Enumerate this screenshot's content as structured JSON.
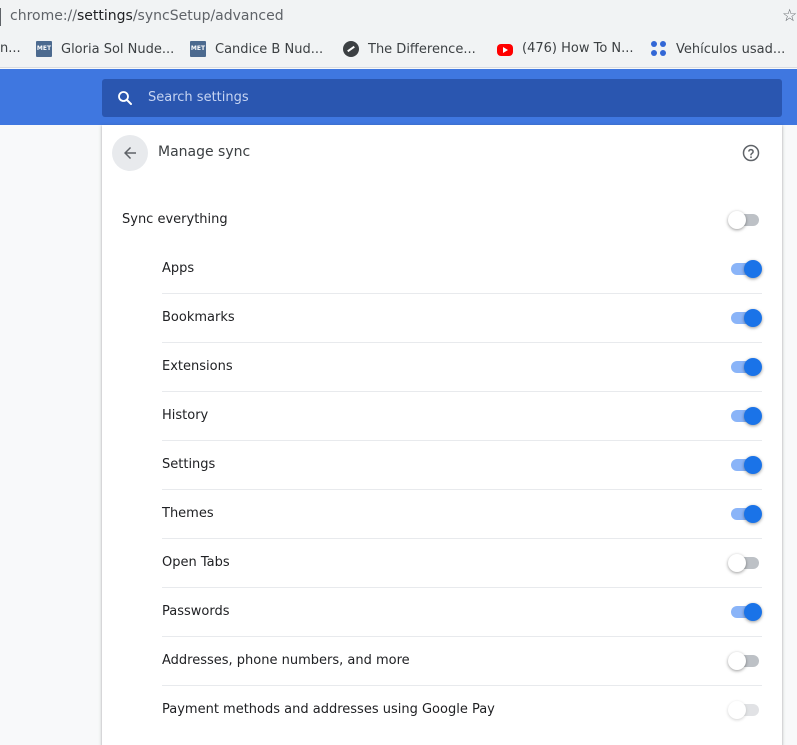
{
  "address_bar": {
    "scheme": "chrome://",
    "host": "settings",
    "path": "/syncSetup/advanced"
  },
  "bookmarks": [
    {
      "label": "Gloria Sol Nude...",
      "icon": "met-favicon",
      "icon_text": "MET"
    },
    {
      "label": "Candice B Nud...",
      "icon": "met-favicon",
      "icon_text": "MET"
    },
    {
      "label": "The Difference...",
      "icon": "dark-circle-favicon"
    },
    {
      "label": "(476) How To N...",
      "icon": "youtube-favicon"
    },
    {
      "label": "Vehículos usad...",
      "icon": "dots-favicon"
    }
  ],
  "bookmark_cutoff": "n...",
  "search": {
    "placeholder": "Search settings"
  },
  "page": {
    "title": "Manage sync"
  },
  "sync_everything": {
    "label": "Sync everything",
    "enabled": false
  },
  "sync_items": [
    {
      "label": "Apps",
      "enabled": true
    },
    {
      "label": "Bookmarks",
      "enabled": true
    },
    {
      "label": "Extensions",
      "enabled": true
    },
    {
      "label": "History",
      "enabled": true
    },
    {
      "label": "Settings",
      "enabled": true
    },
    {
      "label": "Themes",
      "enabled": true
    },
    {
      "label": "Open Tabs",
      "enabled": false
    },
    {
      "label": "Passwords",
      "enabled": true
    },
    {
      "label": "Addresses, phone numbers, and more",
      "enabled": false
    },
    {
      "label": "Payment methods and addresses using Google Pay",
      "enabled": false,
      "disabled": true
    }
  ],
  "colors": {
    "accent": "#1a73e8",
    "header": "#3f77e0",
    "search_bg": "#2a56b0"
  }
}
